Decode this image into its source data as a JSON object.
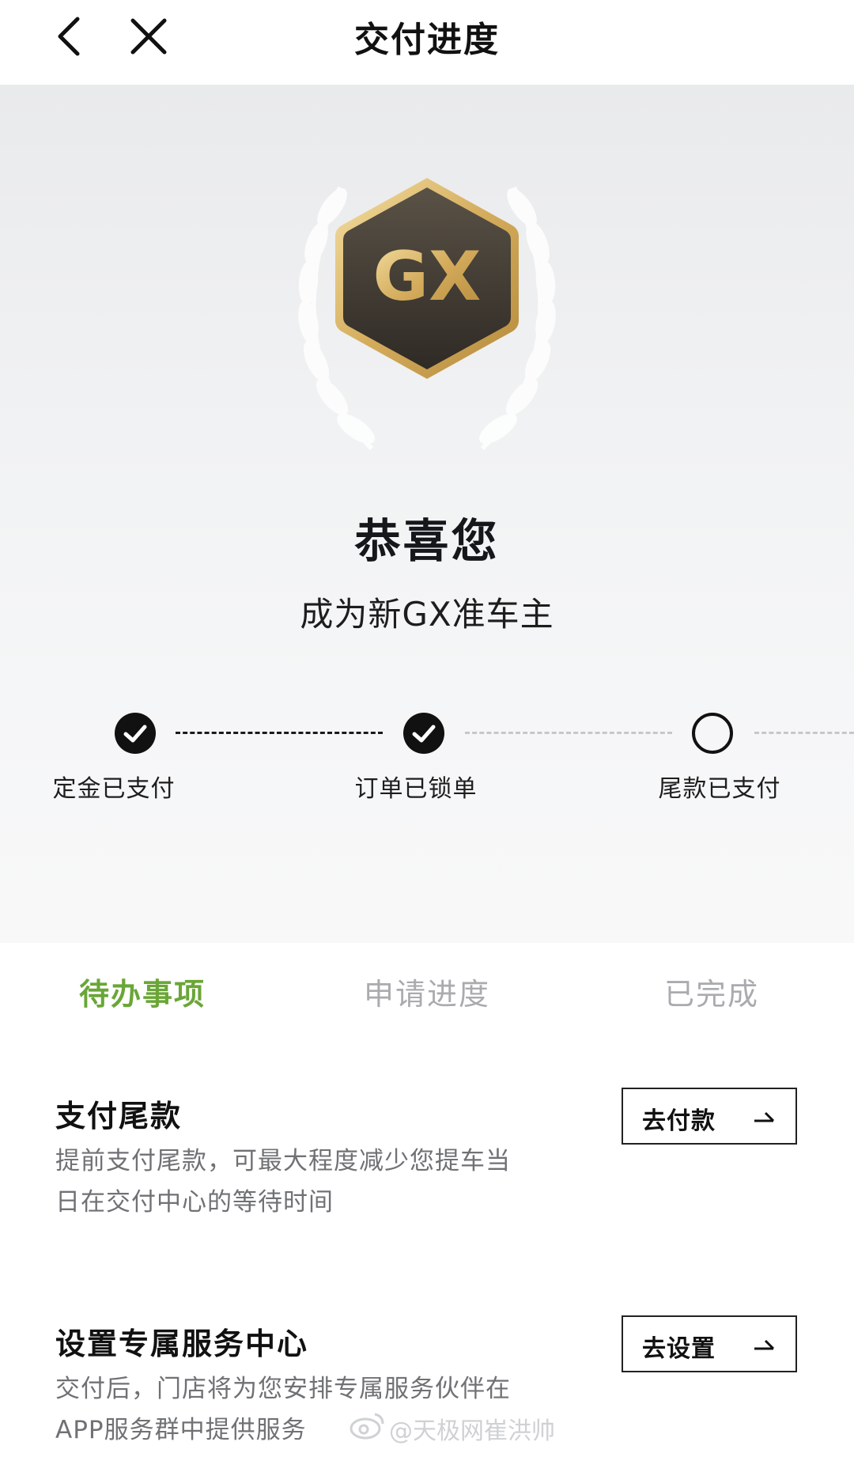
{
  "header": {
    "title": "交付进度"
  },
  "hero": {
    "badge_text": "GX",
    "congrats": "恭喜您",
    "subtitle": "成为新GX准车主"
  },
  "progress": {
    "steps": [
      {
        "label": "定金已支付",
        "done": true
      },
      {
        "label": "订单已锁单",
        "done": true
      },
      {
        "label": "尾款已支付",
        "done": false
      }
    ]
  },
  "tabs": [
    {
      "label": "待办事项",
      "active": true
    },
    {
      "label": "申请进度",
      "active": false
    },
    {
      "label": "已完成",
      "active": false
    }
  ],
  "tasks": [
    {
      "title": "支付尾款",
      "desc_line1": "提前支付尾款，可最大程度减少您提车当",
      "desc_line2": "日在交付中心的等待时间",
      "button": "去付款"
    },
    {
      "title": "设置专属服务中心",
      "desc_line1": "交付后，门店将为您安排专属服务伙伴在",
      "desc_line2": "APP服务群中提供服务",
      "button": "去设置"
    }
  ],
  "watermark": "@天极网崔洪帅",
  "colors": {
    "accent_green": "#6aa637",
    "badge_gold": "#d9b56a",
    "badge_dark": "#4a4238"
  }
}
